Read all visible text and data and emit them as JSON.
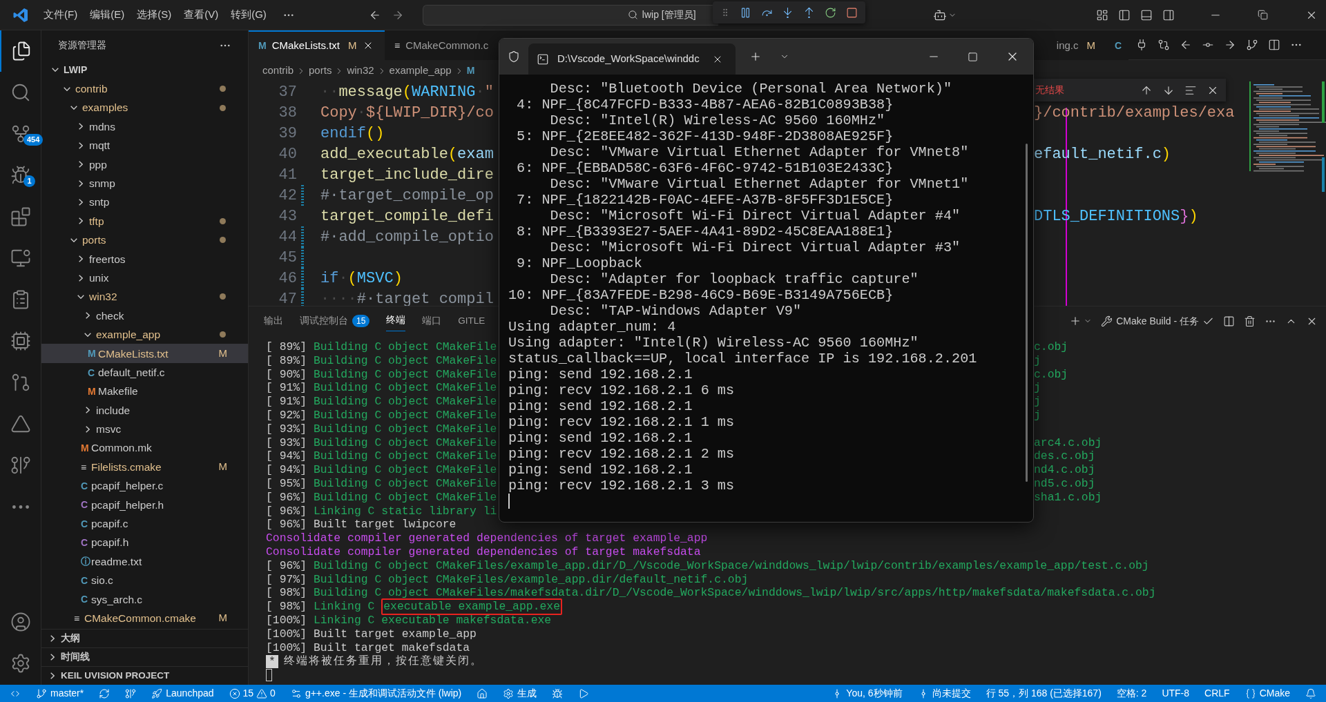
{
  "title_bar": {
    "menus": [
      "文件(F)",
      "编辑(E)",
      "选择(S)",
      "查看(V)",
      "转到(G)"
    ],
    "search": "lwip [管理员]"
  },
  "activity_bar": {
    "items": [
      {
        "kind": "explorer",
        "selected": true
      },
      {
        "kind": "search",
        "selected": false
      },
      {
        "kind": "source-control",
        "selected": false,
        "badge": "454"
      },
      {
        "kind": "debug",
        "selected": false,
        "badge": "1"
      },
      {
        "kind": "extensions",
        "selected": false
      },
      {
        "kind": "remote",
        "selected": false
      },
      {
        "kind": "tasks",
        "selected": false
      },
      {
        "kind": "chip",
        "selected": false
      },
      {
        "kind": "gitlens",
        "selected": false
      },
      {
        "kind": "tool",
        "selected": false
      },
      {
        "kind": "graph",
        "selected": false
      },
      {
        "kind": "more",
        "selected": false
      }
    ]
  },
  "sidebar": {
    "title": "资源管理器",
    "root": {
      "name": "LWIP",
      "expanded": true,
      "children": [
        {
          "name": "contrib",
          "kind": "folder",
          "expanded": true,
          "selected": false,
          "dot": true,
          "children": [
            {
              "name": "examples",
              "kind": "folder",
              "expanded": true,
              "selected": false,
              "dot": true,
              "children": [
                {
                  "name": "mdns",
                  "kind": "folder",
                  "expanded": false,
                  "selected": false,
                  "dot": false
                },
                {
                  "name": "mqtt",
                  "kind": "folder",
                  "expanded": false,
                  "selected": false,
                  "dot": false
                },
                {
                  "name": "ppp",
                  "kind": "folder",
                  "expanded": false,
                  "selected": false,
                  "dot": false
                },
                {
                  "name": "snmp",
                  "kind": "folder",
                  "expanded": false,
                  "selected": false,
                  "dot": false
                },
                {
                  "name": "sntp",
                  "kind": "folder",
                  "expanded": false,
                  "selected": false,
                  "dot": false
                },
                {
                  "name": "tftp",
                  "kind": "folder",
                  "expanded": false,
                  "selected": false,
                  "dot": true
                }
              ]
            },
            {
              "name": "ports",
              "kind": "folder",
              "expanded": true,
              "selected": false,
              "dot": true,
              "children": [
                {
                  "name": "freertos",
                  "kind": "folder",
                  "expanded": false,
                  "selected": false,
                  "dot": false
                },
                {
                  "name": "unix",
                  "kind": "folder",
                  "expanded": false,
                  "selected": false,
                  "dot": false
                },
                {
                  "name": "win32",
                  "kind": "folder",
                  "expanded": true,
                  "selected": false,
                  "dot": true,
                  "children": [
                    {
                      "name": "check",
                      "kind": "folder",
                      "expanded": false,
                      "selected": false,
                      "dot": false
                    },
                    {
                      "name": "example_app",
                      "kind": "folder",
                      "expanded": true,
                      "selected": false,
                      "dot": true,
                      "children": [
                        {
                          "name": "CMakeLists.txt",
                          "kind": "file",
                          "glyph": "M",
                          "color": "#519aba",
                          "badge": "M",
                          "selected": true,
                          "dot": false
                        },
                        {
                          "name": "default_netif.c",
                          "kind": "file",
                          "glyph": "C",
                          "color": "#519aba",
                          "selected": false,
                          "dot": false
                        },
                        {
                          "name": "Makefile",
                          "kind": "file",
                          "glyph": "M",
                          "color": "#e37933",
                          "selected": false,
                          "dot": false
                        }
                      ]
                    },
                    {
                      "name": "include",
                      "kind": "folder",
                      "expanded": false,
                      "selected": false,
                      "dot": false
                    },
                    {
                      "name": "msvc",
                      "kind": "folder",
                      "expanded": false,
                      "selected": false,
                      "dot": false
                    },
                    {
                      "name": "Common.mk",
                      "kind": "file",
                      "glyph": "M",
                      "color": "#e37933",
                      "selected": false,
                      "dot": false
                    },
                    {
                      "name": "Filelists.cmake",
                      "kind": "file",
                      "glyph": "≡",
                      "color": "#cccccc",
                      "badge": "M",
                      "selected": false,
                      "dot": false
                    },
                    {
                      "name": "pcapif_helper.c",
                      "kind": "file",
                      "glyph": "C",
                      "color": "#519aba",
                      "selected": false,
                      "dot": false
                    },
                    {
                      "name": "pcapif_helper.h",
                      "kind": "file",
                      "glyph": "C",
                      "color": "#a074c4",
                      "selected": false,
                      "dot": false
                    },
                    {
                      "name": "pcapif.c",
                      "kind": "file",
                      "glyph": "C",
                      "color": "#519aba",
                      "selected": false,
                      "dot": false
                    },
                    {
                      "name": "pcapif.h",
                      "kind": "file",
                      "glyph": "C",
                      "color": "#a074c4",
                      "selected": false,
                      "dot": false
                    },
                    {
                      "name": "readme.txt",
                      "kind": "file",
                      "glyph": "ⓘ",
                      "color": "#519aba",
                      "selected": false,
                      "dot": false
                    },
                    {
                      "name": "sio.c",
                      "kind": "file",
                      "glyph": "C",
                      "color": "#519aba",
                      "selected": false,
                      "dot": false
                    },
                    {
                      "name": "sys_arch.c",
                      "kind": "file",
                      "glyph": "C",
                      "color": "#519aba",
                      "selected": false,
                      "dot": false
                    }
                  ]
                },
                {
                  "name": "CMakeCommon.cmake",
                  "kind": "file",
                  "glyph": "≡",
                  "color": "#cccccc",
                  "badge": "M",
                  "selected": false,
                  "dot": false
                }
              ]
            }
          ]
        }
      ]
    },
    "sections": [
      {
        "name": "大纲",
        "expanded": false
      },
      {
        "name": "时间线",
        "expanded": false
      },
      {
        "name": "KEIL UVISION PROJECT",
        "expanded": false
      }
    ]
  },
  "editor": {
    "tabs": [
      {
        "name": "CMakeLists.txt",
        "glyph": "M",
        "badge": "M",
        "selected": true
      },
      {
        "name": "CMakeCommon.c",
        "glyph": "≡",
        "selected": false
      },
      {
        "name": "ing.c",
        "badge": "M",
        "selected": false
      },
      {
        "glyph": "C",
        "selected": false
      }
    ],
    "breadcrumb": {
      "folders": [
        "contrib",
        "ports",
        "win32",
        "example_app"
      ],
      "file_glyph": "M"
    },
    "find": {
      "result": "无结果"
    },
    "lines": [
      {
        "number": "37",
        "changed": false,
        "tokens": [
          {
            "text": "··",
            "kind": "ws"
          },
          {
            "text": "message",
            "kind": "fn"
          },
          {
            "text": "(",
            "kind": "paren"
          },
          {
            "text": "WARNING",
            "kind": "const"
          },
          {
            "text": "·",
            "kind": "ws"
          },
          {
            "text": "\"",
            "kind": "str"
          }
        ]
      },
      {
        "number": "38",
        "changed": false,
        "tokens": [
          {
            "text": "Copy",
            "kind": "str"
          },
          {
            "text": "·",
            "kind": "ws"
          },
          {
            "text": "${LWIP_DIR}/co",
            "kind": "str"
          }
        ],
        "tail": [
          {
            "text": "}/contrib/examples/exa",
            "kind": "str"
          }
        ]
      },
      {
        "number": "39",
        "changed": false,
        "tokens": [
          {
            "text": "endif",
            "kind": "kw"
          },
          {
            "text": "()",
            "kind": "paren"
          }
        ]
      },
      {
        "number": "40",
        "changed": false,
        "tokens": [
          {
            "text": "add_executable",
            "kind": "fn"
          },
          {
            "text": "(",
            "kind": "paren"
          },
          {
            "text": "exam",
            "kind": "plain"
          }
        ],
        "tail": [
          {
            "text": "efault_netif.c",
            "kind": "plain"
          },
          {
            "text": ")",
            "kind": "paren"
          }
        ]
      },
      {
        "number": "41",
        "changed": false,
        "tokens": [
          {
            "text": "target_include_dire",
            "kind": "fn"
          }
        ]
      },
      {
        "number": "42",
        "changed": true,
        "tokens": [
          {
            "text": "#·target_compile_op",
            "kind": "comment"
          }
        ]
      },
      {
        "number": "43",
        "changed": false,
        "tokens": [
          {
            "text": "target_compile_defi",
            "kind": "fn"
          }
        ],
        "tail": [
          {
            "text": "DTLS_DEFINITIONS",
            "kind": "const"
          },
          {
            "text": "}",
            "kind": "brace"
          },
          {
            "text": ")",
            "kind": "paren"
          }
        ]
      },
      {
        "number": "44",
        "changed": true,
        "tokens": [
          {
            "text": "#·add_compile_optio",
            "kind": "comment"
          }
        ]
      },
      {
        "number": "45",
        "changed": true
      },
      {
        "number": "46",
        "changed": true,
        "tokens": [
          {
            "text": "if",
            "kind": "kw"
          },
          {
            "text": "·",
            "kind": "ws"
          },
          {
            "text": "(",
            "kind": "paren"
          },
          {
            "text": "MSVC",
            "kind": "const"
          },
          {
            "text": ")",
            "kind": "paren"
          }
        ]
      },
      {
        "number": "47",
        "changed": true,
        "tokens": [
          {
            "text": "····",
            "kind": "ws"
          },
          {
            "text": "#·target compil",
            "kind": "comment"
          }
        ]
      }
    ]
  },
  "panel": {
    "tabs": [
      {
        "label": "输出",
        "selected": false
      },
      {
        "label": "调试控制台",
        "badge": "15",
        "selected": false
      },
      {
        "label": "终端",
        "selected": true
      },
      {
        "label": "端口",
        "selected": false
      },
      {
        "label": "GITLE",
        "selected": false
      }
    ],
    "task": "CMake Build - 任务",
    "lines": [
      {
        "kind": "build",
        "prefix": "[ 89%]",
        "text": "Building C object CMakeFile",
        "tail": "c.obj"
      },
      {
        "kind": "build",
        "prefix": "[ 89%]",
        "text": "Building C object CMakeFile",
        "tail": "j"
      },
      {
        "kind": "build",
        "prefix": "[ 90%]",
        "text": "Building C object CMakeFile",
        "tail": "c.obj"
      },
      {
        "kind": "build",
        "prefix": "[ 91%]",
        "text": "Building C object CMakeFile",
        "tail": "j"
      },
      {
        "kind": "build",
        "prefix": "[ 91%]",
        "text": "Building C object CMakeFile",
        "tail": "j"
      },
      {
        "kind": "build",
        "prefix": "[ 92%]",
        "text": "Building C object CMakeFile",
        "tail": "j"
      },
      {
        "kind": "build",
        "prefix": "[ 93%]",
        "text": "Building C object CMakeFile"
      },
      {
        "kind": "build",
        "prefix": "[ 93%]",
        "text": "Building C object CMakeFile",
        "tail": "arc4.c.obj"
      },
      {
        "kind": "build",
        "prefix": "[ 94%]",
        "text": "Building C object CMakeFile",
        "tail": "des.c.obj"
      },
      {
        "kind": "build",
        "prefix": "[ 94%]",
        "text": "Building C object CMakeFile",
        "tail": "nd4.c.obj"
      },
      {
        "kind": "build",
        "prefix": "[ 95%]",
        "text": "Building C object CMakeFile",
        "tail": "nd5.c.obj"
      },
      {
        "kind": "build",
        "prefix": "[ 96%]",
        "text": "Building C object CMakeFile",
        "tail": "sha1.c.obj"
      },
      {
        "kind": "build",
        "prefix": "[ 96%]",
        "text": "Linking C static library li"
      },
      {
        "kind": "plain",
        "prefix": "[ 96%]",
        "text": "Built target lwipcore"
      },
      {
        "kind": "note",
        "text": "Consolidate compiler generated dependencies of target example_app"
      },
      {
        "kind": "note",
        "text": "Consolidate compiler generated dependencies of target makefsdata"
      },
      {
        "kind": "build",
        "prefix": "[ 96%]",
        "text": "Building C object CMakeFiles/example_app.dir/D_/Vscode_WorkSpace/winddows_lwip/lwip/contrib/examples/example_app/test.c.obj"
      },
      {
        "kind": "build",
        "prefix": "[ 97%]",
        "text": "Building C object CMakeFiles/example_app.dir/default_netif.c.obj"
      },
      {
        "kind": "build",
        "prefix": "[ 98%]",
        "text": "Building C object CMakeFiles/makefsdata.dir/D_/Vscode_WorkSpace/winddows_lwip/lwip/src/apps/http/makefsdata/makefsdata.c.obj"
      },
      {
        "kind": "build",
        "prefix": "[ 98%]",
        "text": "Linking C",
        "boxed": "executable example_app.exe"
      },
      {
        "kind": "build",
        "prefix": "[100%]",
        "text": "Linking C executable makefsdata.exe"
      },
      {
        "kind": "plain",
        "prefix": "[100%]",
        "text": "Built target example_app"
      },
      {
        "kind": "plain",
        "prefix": "[100%]",
        "text": "Built target makefsdata"
      }
    ],
    "prompt": {
      "marker": "*",
      "text": "终端将被任务重用，按任意键关闭。"
    }
  },
  "terminal_window": {
    "tab_title": "D:\\Vscode_WorkSpace\\winddc",
    "lines": [
      "     Desc: \"Bluetooth Device (Personal Area Network)\"",
      " 4: NPF_{8C47FCFD-B333-4B87-AEA6-82B1C0893B38}",
      "     Desc: \"Intel(R) Wireless-AC 9560 160MHz\"",
      " 5: NPF_{2E8EE482-362F-413D-948F-2D3808AE925F}",
      "     Desc: \"VMware Virtual Ethernet Adapter for VMnet8\"",
      " 6: NPF_{EBBAD58C-63F6-4F6C-9742-51B103E2433C}",
      "     Desc: \"VMware Virtual Ethernet Adapter for VMnet1\"",
      " 7: NPF_{1822142B-F0AC-4EFE-A37B-8F5FF3D1E5CE}",
      "     Desc: \"Microsoft Wi-Fi Direct Virtual Adapter #4\"",
      " 8: NPF_{B3393E27-5AEF-4A41-89D2-45C8EAA188E1}",
      "     Desc: \"Microsoft Wi-Fi Direct Virtual Adapter #3\"",
      " 9: NPF_Loopback",
      "     Desc: \"Adapter for loopback traffic capture\"",
      "10: NPF_{83A7FEDE-B298-46C9-B69E-B3149A756ECB}",
      "     Desc: \"TAP-Windows Adapter V9\"",
      "Using adapter_num: 4",
      "Using adapter: \"Intel(R) Wireless-AC 9560 160MHz\"",
      "status_callback==UP, local interface IP is 192.168.2.201",
      "ping: send 192.168.2.1",
      "ping: recv 192.168.2.1 6 ms",
      "ping: send 192.168.2.1",
      "ping: recv 192.168.2.1 1 ms",
      "ping: send 192.168.2.1",
      "ping: recv 192.168.2.1 2 ms",
      "ping: send 192.168.2.1",
      "ping: recv 192.168.2.1 3 ms"
    ]
  },
  "status_bar": {
    "left": [
      {
        "kind": "remote"
      },
      {
        "kind": "branch",
        "text": "master*"
      },
      {
        "kind": "sync"
      },
      {
        "kind": "graph"
      },
      {
        "kind": "launchpad",
        "text": "Launchpad"
      },
      {
        "kind": "problems",
        "errors": "15",
        "warnings": "0"
      },
      {
        "kind": "debug-config",
        "text": "g++.exe - 生成和调试活动文件 (lwip)"
      },
      {
        "kind": "home"
      },
      {
        "kind": "build",
        "text": "生成"
      },
      {
        "kind": "bug"
      },
      {
        "kind": "run"
      }
    ],
    "right": [
      {
        "kind": "blame",
        "text": "You, 6秒钟前"
      },
      {
        "kind": "commit",
        "text": "尚未提交"
      },
      {
        "kind": "text",
        "text": "行 55，列 168 (已选择167)"
      },
      {
        "kind": "text",
        "text": "空格: 2"
      },
      {
        "kind": "text",
        "text": "UTF-8"
      },
      {
        "kind": "text",
        "text": "CRLF"
      },
      {
        "kind": "language",
        "text": "CMake"
      },
      {
        "kind": "bell"
      }
    ]
  }
}
